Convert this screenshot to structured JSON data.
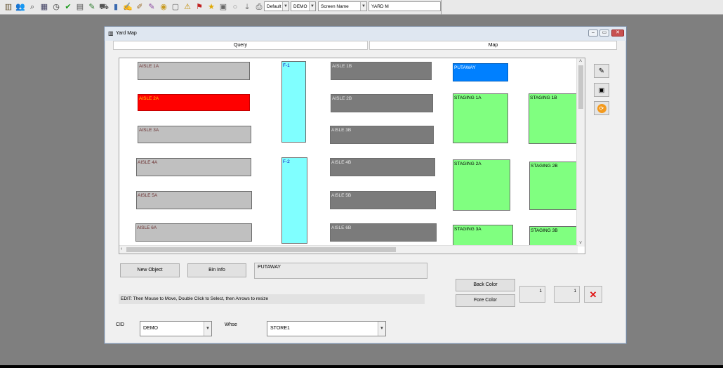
{
  "toolbar": {
    "icons": [
      "building-icon",
      "users-icon",
      "binoculars-icon",
      "calendar-icon",
      "clock-icon",
      "checkmark-icon",
      "list-icon",
      "wrench-icon",
      "truck-icon",
      "chart-icon",
      "edit-icon",
      "note-icon",
      "tag-icon",
      "bubble-icon",
      "document-icon",
      "warning-icon",
      "flag-icon",
      "star-icon",
      "camera-icon",
      "globe-icon",
      "download-icon",
      "print-icon"
    ],
    "icon_glyphs": [
      "▥",
      "👥",
      "⌕",
      "▦",
      "◷",
      "✔",
      "▤",
      "✎",
      "⛟",
      "▮",
      "✍",
      "✐",
      "✎",
      "◉",
      "▢",
      "⚠",
      "⚑",
      "★",
      "▣",
      "○",
      "⤓",
      "⎙"
    ],
    "combo1": "Default",
    "combo2": "DEMO",
    "combo3": "Screen Name",
    "combo4": "YARD M"
  },
  "window": {
    "title": "Yard Map",
    "tabs": [
      "Query",
      "Map"
    ]
  },
  "map": {
    "blocks": [
      {
        "label": "AISLE 1A",
        "style": "light"
      },
      {
        "label": "AISLE 2A",
        "style": "red"
      },
      {
        "label": "AISLE 3A",
        "style": "light"
      },
      {
        "label": "AISLE 4A",
        "style": "light"
      },
      {
        "label": "AISLE 5A",
        "style": "light"
      },
      {
        "label": "AISLE 6A",
        "style": "light"
      },
      {
        "label": "F-1",
        "style": "cyan"
      },
      {
        "label": "F-2",
        "style": "cyan"
      },
      {
        "label": "AISLE 1B",
        "style": "dark"
      },
      {
        "label": "AISLE 2B",
        "style": "dark"
      },
      {
        "label": "AISLE 3B",
        "style": "dark"
      },
      {
        "label": "AISLE 4B",
        "style": "dark"
      },
      {
        "label": "AISLE 5B",
        "style": "dark"
      },
      {
        "label": "AISLE 6B",
        "style": "dark"
      },
      {
        "label": "PUTAWAY",
        "style": "blue"
      },
      {
        "label": "STAGING 1A",
        "style": "green"
      },
      {
        "label": "STAGING 1B",
        "style": "green"
      },
      {
        "label": "STAGING 2A",
        "style": "green"
      },
      {
        "label": "STAGING 2B",
        "style": "green"
      },
      {
        "label": "STAGING 3A",
        "style": "green"
      },
      {
        "label": "STAGING 3B",
        "style": "green"
      }
    ]
  },
  "controls": {
    "new_object": "New Object",
    "bin_info": "Bin Info",
    "selected_name": "PUTAWAY",
    "edit_info": "EDIT: Then Mouse to Move, Double Click to Select, then Arrows to resize",
    "back_color": "Back Color",
    "fore_color": "Fore Color",
    "width_value": "1",
    "height_value": "1",
    "cid_label": "CID",
    "cid_value": "DEMO",
    "whse_label": "Whse",
    "whse_value": "STORE1"
  },
  "colors": {
    "selected_block": "#ff0000",
    "putaway": "#0080ff",
    "staging": "#80ff80",
    "flow": "#80ffff"
  }
}
